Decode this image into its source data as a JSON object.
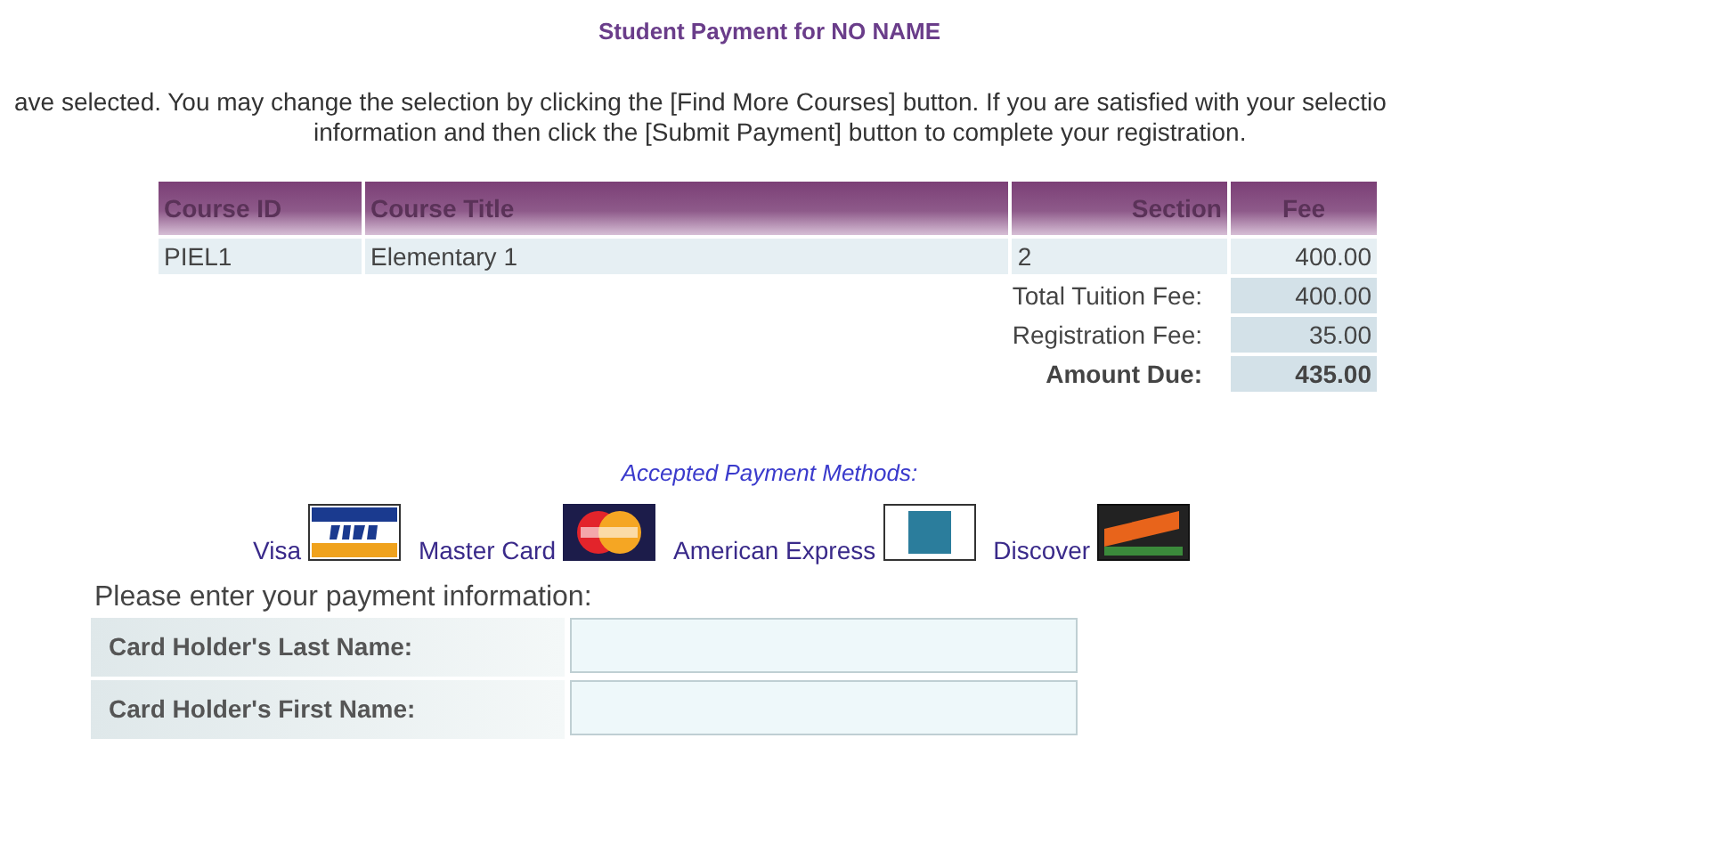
{
  "title": "Student Payment for NO NAME",
  "intro": [
    "ave selected. You may change the selection by clicking the [Find More Courses] button. If you are satisfied with your selectio",
    "information and then click the [Submit Payment] button to complete your registration."
  ],
  "courses": {
    "columns": [
      "Course ID",
      "Course Title",
      "Section",
      "Fee"
    ],
    "rows": [
      {
        "course_id": "PIEL1",
        "course_title": "Elementary 1",
        "section": "2",
        "fee": "400.00"
      }
    ],
    "totals": [
      {
        "label": "Total Tuition Fee:",
        "value": "400.00",
        "bold": false
      },
      {
        "label": "Registration Fee:",
        "value": "35.00",
        "bold": false
      },
      {
        "label": "Amount Due:",
        "value": "435.00",
        "bold": true
      }
    ]
  },
  "payment_methods": {
    "heading": "Accepted Payment Methods:",
    "cards": [
      {
        "name": "Visa",
        "kind": "visa"
      },
      {
        "name": "Master Card",
        "kind": "mastercard"
      },
      {
        "name": "American Express",
        "kind": "amex"
      },
      {
        "name": "Discover",
        "kind": "discover"
      }
    ]
  },
  "payment_form": {
    "heading": "Please enter your payment information:",
    "fields": [
      {
        "label": "Card Holder's Last Name:"
      },
      {
        "label": "Card Holder's First Name:"
      }
    ]
  }
}
